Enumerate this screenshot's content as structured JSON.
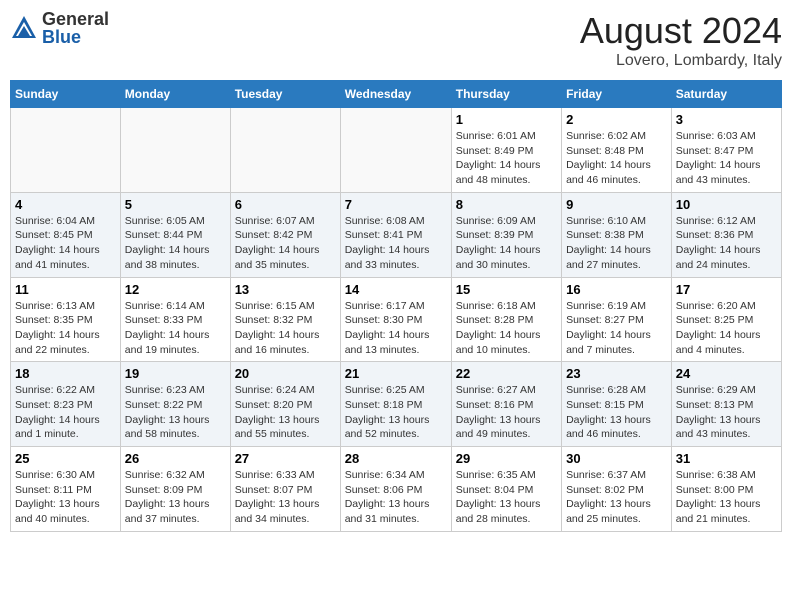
{
  "header": {
    "logo_general": "General",
    "logo_blue": "Blue",
    "month_year": "August 2024",
    "location": "Lovero, Lombardy, Italy"
  },
  "days_of_week": [
    "Sunday",
    "Monday",
    "Tuesday",
    "Wednesday",
    "Thursday",
    "Friday",
    "Saturday"
  ],
  "weeks": [
    [
      {
        "day": "",
        "info": ""
      },
      {
        "day": "",
        "info": ""
      },
      {
        "day": "",
        "info": ""
      },
      {
        "day": "",
        "info": ""
      },
      {
        "day": "1",
        "info": "Sunrise: 6:01 AM\nSunset: 8:49 PM\nDaylight: 14 hours and 48 minutes."
      },
      {
        "day": "2",
        "info": "Sunrise: 6:02 AM\nSunset: 8:48 PM\nDaylight: 14 hours and 46 minutes."
      },
      {
        "day": "3",
        "info": "Sunrise: 6:03 AM\nSunset: 8:47 PM\nDaylight: 14 hours and 43 minutes."
      }
    ],
    [
      {
        "day": "4",
        "info": "Sunrise: 6:04 AM\nSunset: 8:45 PM\nDaylight: 14 hours and 41 minutes."
      },
      {
        "day": "5",
        "info": "Sunrise: 6:05 AM\nSunset: 8:44 PM\nDaylight: 14 hours and 38 minutes."
      },
      {
        "day": "6",
        "info": "Sunrise: 6:07 AM\nSunset: 8:42 PM\nDaylight: 14 hours and 35 minutes."
      },
      {
        "day": "7",
        "info": "Sunrise: 6:08 AM\nSunset: 8:41 PM\nDaylight: 14 hours and 33 minutes."
      },
      {
        "day": "8",
        "info": "Sunrise: 6:09 AM\nSunset: 8:39 PM\nDaylight: 14 hours and 30 minutes."
      },
      {
        "day": "9",
        "info": "Sunrise: 6:10 AM\nSunset: 8:38 PM\nDaylight: 14 hours and 27 minutes."
      },
      {
        "day": "10",
        "info": "Sunrise: 6:12 AM\nSunset: 8:36 PM\nDaylight: 14 hours and 24 minutes."
      }
    ],
    [
      {
        "day": "11",
        "info": "Sunrise: 6:13 AM\nSunset: 8:35 PM\nDaylight: 14 hours and 22 minutes."
      },
      {
        "day": "12",
        "info": "Sunrise: 6:14 AM\nSunset: 8:33 PM\nDaylight: 14 hours and 19 minutes."
      },
      {
        "day": "13",
        "info": "Sunrise: 6:15 AM\nSunset: 8:32 PM\nDaylight: 14 hours and 16 minutes."
      },
      {
        "day": "14",
        "info": "Sunrise: 6:17 AM\nSunset: 8:30 PM\nDaylight: 14 hours and 13 minutes."
      },
      {
        "day": "15",
        "info": "Sunrise: 6:18 AM\nSunset: 8:28 PM\nDaylight: 14 hours and 10 minutes."
      },
      {
        "day": "16",
        "info": "Sunrise: 6:19 AM\nSunset: 8:27 PM\nDaylight: 14 hours and 7 minutes."
      },
      {
        "day": "17",
        "info": "Sunrise: 6:20 AM\nSunset: 8:25 PM\nDaylight: 14 hours and 4 minutes."
      }
    ],
    [
      {
        "day": "18",
        "info": "Sunrise: 6:22 AM\nSunset: 8:23 PM\nDaylight: 14 hours and 1 minute."
      },
      {
        "day": "19",
        "info": "Sunrise: 6:23 AM\nSunset: 8:22 PM\nDaylight: 13 hours and 58 minutes."
      },
      {
        "day": "20",
        "info": "Sunrise: 6:24 AM\nSunset: 8:20 PM\nDaylight: 13 hours and 55 minutes."
      },
      {
        "day": "21",
        "info": "Sunrise: 6:25 AM\nSunset: 8:18 PM\nDaylight: 13 hours and 52 minutes."
      },
      {
        "day": "22",
        "info": "Sunrise: 6:27 AM\nSunset: 8:16 PM\nDaylight: 13 hours and 49 minutes."
      },
      {
        "day": "23",
        "info": "Sunrise: 6:28 AM\nSunset: 8:15 PM\nDaylight: 13 hours and 46 minutes."
      },
      {
        "day": "24",
        "info": "Sunrise: 6:29 AM\nSunset: 8:13 PM\nDaylight: 13 hours and 43 minutes."
      }
    ],
    [
      {
        "day": "25",
        "info": "Sunrise: 6:30 AM\nSunset: 8:11 PM\nDaylight: 13 hours and 40 minutes."
      },
      {
        "day": "26",
        "info": "Sunrise: 6:32 AM\nSunset: 8:09 PM\nDaylight: 13 hours and 37 minutes."
      },
      {
        "day": "27",
        "info": "Sunrise: 6:33 AM\nSunset: 8:07 PM\nDaylight: 13 hours and 34 minutes."
      },
      {
        "day": "28",
        "info": "Sunrise: 6:34 AM\nSunset: 8:06 PM\nDaylight: 13 hours and 31 minutes."
      },
      {
        "day": "29",
        "info": "Sunrise: 6:35 AM\nSunset: 8:04 PM\nDaylight: 13 hours and 28 minutes."
      },
      {
        "day": "30",
        "info": "Sunrise: 6:37 AM\nSunset: 8:02 PM\nDaylight: 13 hours and 25 minutes."
      },
      {
        "day": "31",
        "info": "Sunrise: 6:38 AM\nSunset: 8:00 PM\nDaylight: 13 hours and 21 minutes."
      }
    ]
  ]
}
